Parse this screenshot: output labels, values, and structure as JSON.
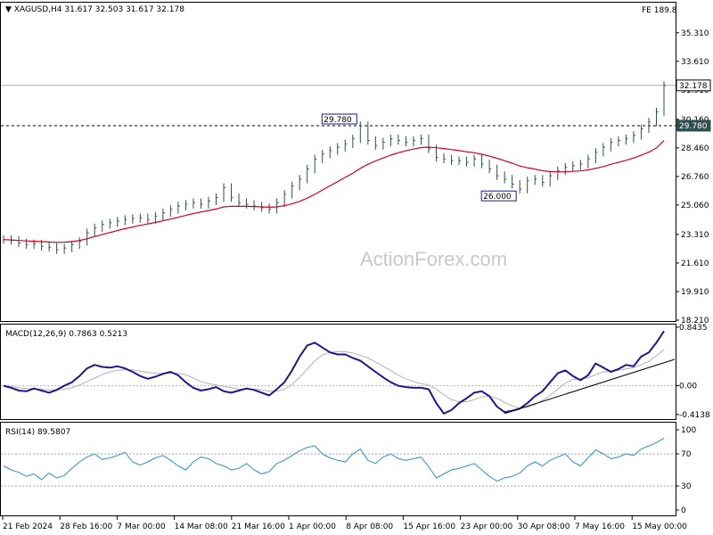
{
  "header": {
    "symbol_line": "▼ XAGUSD,H4  31.617 32.503 31.617 32.178",
    "indicator_tag": "FE 189.8"
  },
  "watermark": "ActionForex.com",
  "colors": {
    "price": "#2f4f4f",
    "ma": "#d4001f",
    "macd": "#1a1a8c",
    "signal": "#b0b0b0",
    "rsi": "#2b8fd6",
    "hline": "#000000"
  },
  "chart_data": [
    {
      "type": "line",
      "panel": "price",
      "series": [
        {
          "values": [
            23.0,
            22.95,
            22.8,
            22.7,
            22.75,
            22.6,
            22.55,
            22.4,
            22.5,
            22.7,
            22.9,
            23.4,
            23.7,
            23.9,
            24.0,
            24.1,
            24.2,
            24.25,
            24.3,
            24.2,
            24.4,
            24.6,
            24.8,
            25.0,
            25.1,
            25.2,
            25.1,
            25.3,
            25.5,
            26.1,
            25.5,
            25.2,
            25.1,
            25.0,
            24.9,
            24.8,
            25.2,
            25.7,
            26.2,
            26.6,
            27.2,
            27.8,
            28.1,
            28.3,
            28.5,
            28.7,
            29.0,
            29.78,
            28.9,
            28.6,
            28.8,
            29.0,
            28.9,
            28.8,
            28.9,
            29.0,
            28.4,
            27.9,
            27.8,
            27.7,
            27.7,
            27.6,
            27.8,
            27.5,
            27.2,
            26.8,
            26.6,
            26.3,
            26.0,
            26.5,
            26.6,
            26.4,
            26.8,
            27.1,
            27.3,
            27.4,
            27.5,
            27.8,
            28.2,
            28.5,
            28.8,
            28.9,
            29.0,
            29.2,
            29.6,
            30.0,
            30.6,
            32.178
          ]
        },
        {
          "values": [
            23.0,
            22.98,
            22.95,
            22.92,
            22.9,
            22.88,
            22.86,
            22.84,
            22.85,
            22.88,
            22.95,
            23.05,
            23.18,
            23.3,
            23.42,
            23.54,
            23.65,
            23.75,
            23.85,
            23.93,
            24.02,
            24.12,
            24.22,
            24.33,
            24.44,
            24.55,
            24.64,
            24.73,
            24.82,
            24.95,
            24.98,
            24.98,
            24.98,
            24.97,
            24.95,
            24.93,
            24.95,
            25.02,
            25.13,
            25.28,
            25.47,
            25.7,
            25.95,
            26.2,
            26.45,
            26.7,
            26.95,
            27.25,
            27.48,
            27.68,
            27.86,
            28.03,
            28.17,
            28.29,
            28.39,
            28.48,
            28.5,
            28.47,
            28.42,
            28.36,
            28.3,
            28.23,
            28.17,
            28.08,
            27.97,
            27.84,
            27.7,
            27.55,
            27.38,
            27.28,
            27.2,
            27.1,
            27.05,
            27.03,
            27.04,
            27.06,
            27.09,
            27.15,
            27.24,
            27.35,
            27.48,
            27.6,
            27.72,
            27.86,
            28.02,
            28.21,
            28.45,
            28.9
          ]
        }
      ],
      "ylim": [
        18.21,
        36.2
      ],
      "yticks": [
        "35.310",
        "33.610",
        "31.910",
        "30.160",
        "28.460",
        "26.760",
        "25.060",
        "23.310",
        "21.610",
        "19.910",
        "18.210"
      ],
      "annotations": [
        {
          "label": "29.780",
          "index": 47,
          "value": 29.78,
          "pos": "above"
        },
        {
          "label": "26.000",
          "index": 68,
          "value": 26.0,
          "pos": "below"
        }
      ],
      "hlines": [
        {
          "value": 29.78,
          "style": "dashed",
          "label": "29.780"
        },
        {
          "value": 32.178,
          "style": "solid",
          "label": "32.178"
        }
      ],
      "grid": false
    },
    {
      "type": "line",
      "panel": "macd",
      "title": "MACD(12,26,9) 0.7863 0.5213",
      "series": [
        {
          "values": [
            0.0,
            -0.03,
            -0.07,
            -0.08,
            -0.04,
            -0.07,
            -0.1,
            -0.06,
            0.0,
            0.05,
            0.14,
            0.25,
            0.3,
            0.27,
            0.26,
            0.28,
            0.25,
            0.2,
            0.14,
            0.1,
            0.13,
            0.17,
            0.2,
            0.15,
            0.05,
            -0.03,
            -0.07,
            -0.05,
            -0.02,
            -0.08,
            -0.1,
            -0.07,
            -0.04,
            -0.06,
            -0.1,
            -0.14,
            -0.05,
            0.05,
            0.22,
            0.42,
            0.58,
            0.62,
            0.55,
            0.48,
            0.45,
            0.45,
            0.4,
            0.36,
            0.28,
            0.2,
            0.12,
            0.05,
            0.0,
            -0.02,
            -0.03,
            -0.03,
            -0.05,
            -0.25,
            -0.4,
            -0.35,
            -0.25,
            -0.18,
            -0.1,
            -0.08,
            -0.15,
            -0.3,
            -0.38,
            -0.36,
            -0.33,
            -0.25,
            -0.15,
            -0.08,
            0.05,
            0.18,
            0.22,
            0.14,
            0.08,
            0.15,
            0.32,
            0.26,
            0.2,
            0.24,
            0.3,
            0.28,
            0.42,
            0.48,
            0.62,
            0.7863
          ]
        },
        {
          "values": [
            0.0,
            -0.01,
            -0.03,
            -0.04,
            -0.04,
            -0.05,
            -0.06,
            -0.06,
            -0.05,
            -0.03,
            0.01,
            0.06,
            0.11,
            0.16,
            0.2,
            0.22,
            0.23,
            0.23,
            0.21,
            0.19,
            0.18,
            0.18,
            0.18,
            0.18,
            0.16,
            0.11,
            0.06,
            0.03,
            0.01,
            -0.01,
            -0.03,
            -0.05,
            -0.05,
            -0.05,
            -0.06,
            -0.08,
            -0.08,
            -0.05,
            0.02,
            0.12,
            0.24,
            0.36,
            0.44,
            0.48,
            0.49,
            0.49,
            0.47,
            0.44,
            0.4,
            0.34,
            0.28,
            0.22,
            0.15,
            0.1,
            0.06,
            0.03,
            0.01,
            -0.05,
            -0.13,
            -0.2,
            -0.23,
            -0.23,
            -0.2,
            -0.16,
            -0.15,
            -0.18,
            -0.24,
            -0.29,
            -0.32,
            -0.31,
            -0.27,
            -0.21,
            -0.14,
            -0.05,
            0.04,
            0.09,
            0.1,
            0.11,
            0.16,
            0.2,
            0.21,
            0.22,
            0.24,
            0.26,
            0.3,
            0.35,
            0.43,
            0.5213
          ]
        }
      ],
      "ylim": [
        -0.48,
        0.88
      ],
      "yticks": [
        "0.8435",
        "0.00",
        "-0.4138"
      ],
      "grid": false
    },
    {
      "type": "line",
      "panel": "rsi",
      "title": "RSI(14) 89.5807",
      "series": [
        {
          "values": [
            55,
            50,
            47,
            42,
            45,
            38,
            46,
            40,
            43,
            52,
            60,
            66,
            70,
            63,
            65,
            68,
            72,
            60,
            56,
            60,
            65,
            68,
            62,
            55,
            50,
            60,
            66,
            64,
            58,
            55,
            50,
            52,
            58,
            50,
            45,
            48,
            58,
            62,
            68,
            74,
            78,
            80,
            70,
            65,
            62,
            60,
            70,
            76,
            62,
            58,
            66,
            70,
            64,
            62,
            64,
            66,
            54,
            40,
            45,
            50,
            52,
            55,
            58,
            50,
            42,
            36,
            40,
            42,
            46,
            55,
            60,
            55,
            62,
            66,
            70,
            60,
            55,
            65,
            75,
            70,
            64,
            66,
            70,
            68,
            76,
            80,
            84,
            89.5807
          ]
        }
      ],
      "ylim": [
        0,
        100
      ],
      "yticks": [
        "100",
        "70",
        "30",
        "0"
      ],
      "levels": [
        70,
        30
      ],
      "grid": false
    }
  ],
  "xticks": [
    "21 Feb 2024",
    "28 Feb 16:00",
    "7 Mar 00:00",
    "14 Mar 08:00",
    "21 Mar 16:00",
    "1 Apr 00:00",
    "8 Apr 08:00",
    "15 Apr 16:00",
    "23 Apr 00:00",
    "30 Apr 08:00",
    "7 May 16:00",
    "15 May 00:00"
  ]
}
